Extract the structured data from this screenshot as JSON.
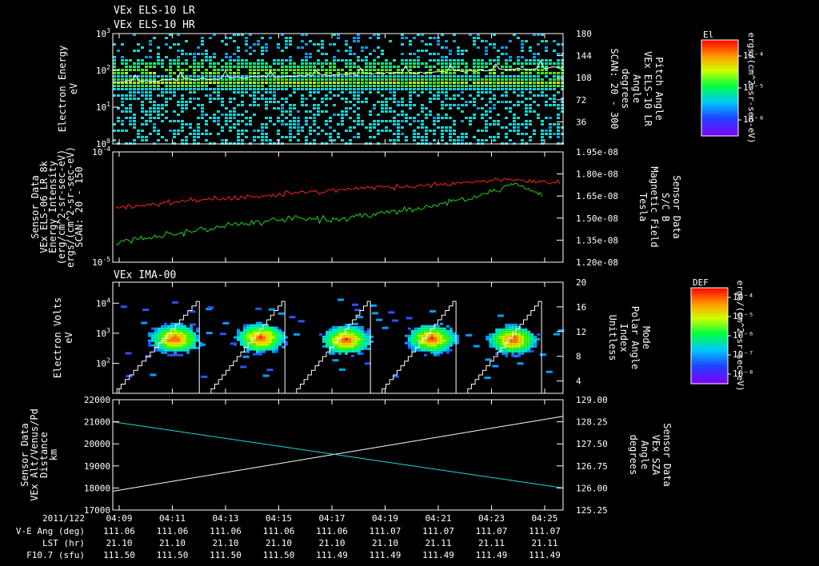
{
  "colors": {
    "background": "#000000",
    "axis": "#ffffff",
    "red_series": "#ff2020",
    "green_series": "#20d020",
    "cyan_series": "#20d8d8",
    "white_series": "#ffffff"
  },
  "chart_data": [
    {
      "id": "panel1",
      "type": "heatmap",
      "titles": [
        "VEx ELS-10 LR",
        "VEx ELS-10 HR"
      ],
      "ylabel": [
        "Electron Energy",
        "eV"
      ],
      "yscale": "log",
      "ylim": [
        1,
        1000
      ],
      "yticks": [
        {
          "v": 1,
          "base": "10",
          "exp": "0"
        },
        {
          "v": 10,
          "base": "10",
          "exp": "1"
        },
        {
          "v": 100,
          "base": "10",
          "exp": "2"
        },
        {
          "v": 1000,
          "base": "10",
          "exp": "3"
        }
      ],
      "y2label": [
        "Pitch Angle",
        "VEx ELS-10 LR",
        "Angle",
        "degrees",
        "SCAN: 20 - 300"
      ],
      "y2lim": [
        0,
        180
      ],
      "y2ticks": [
        "36",
        "72",
        "108",
        "144",
        "180"
      ],
      "overlay_series": {
        "name": "Pitch Angle",
        "color": "#ffffff",
        "band_center_eV": 50,
        "pitch_angle_range": [
          95,
          140
        ]
      },
      "colorbar": {
        "title": "El",
        "unit": "ergs/(cm^2-sr-sec-eV)",
        "labels": [
          "10⁻⁴",
          "10⁻⁵",
          "10⁻⁶"
        ]
      }
    },
    {
      "id": "panel2",
      "type": "line",
      "ylabel": [
        "Sensor Data",
        "VEx ELS-06 LR 8k",
        "Energy Intensity",
        "(erg/cm^2-sr-sec-eV)",
        "ergs/(cm^2-sr-sec-eV)",
        "SCAN: 20 - 150"
      ],
      "ylabel_color": "#ff2020",
      "yscale": "log",
      "ylim": [
        1e-05,
        0.0001
      ],
      "yticks": [
        {
          "v": 1e-05,
          "base": "10",
          "exp": "-5"
        },
        {
          "v": 0.0001,
          "base": "10",
          "exp": "-4"
        }
      ],
      "y2label": [
        "Sensor Data",
        "S/C B",
        "Magnetic Field",
        "Tesla"
      ],
      "y2label_color": "#20d020",
      "y2lim": [
        1.2e-08,
        1.95e-08
      ],
      "y2ticks": [
        "1.20e-08",
        "1.35e-08",
        "1.50e-08",
        "1.65e-08",
        "1.80e-08",
        "1.95e-08"
      ],
      "series": [
        {
          "axis": "left",
          "color": "#ff2020",
          "x": [
            0,
            0.1,
            0.2,
            0.3,
            0.4,
            0.5,
            0.6,
            0.7,
            0.8,
            0.9,
            1.0
          ],
          "values": [
            3.1e-05,
            3.4e-05,
            3.7e-05,
            3.9e-05,
            4.2e-05,
            4.5e-05,
            4.8e-05,
            5e-05,
            5.3e-05,
            5.6e-05,
            5.2e-05
          ]
        },
        {
          "axis": "right",
          "color": "#20d020",
          "x": [
            0,
            0.1,
            0.2,
            0.3,
            0.4,
            0.5,
            0.6,
            0.7,
            0.8,
            0.9,
            0.96
          ],
          "values": [
            1.34e-08,
            1.38e-08,
            1.42e-08,
            1.46e-08,
            1.5e-08,
            1.49e-08,
            1.53e-08,
            1.57e-08,
            1.64e-08,
            1.73e-08,
            1.66e-08
          ]
        }
      ]
    },
    {
      "id": "panel3",
      "type": "heatmap",
      "titles": [
        "VEx IMA-00"
      ],
      "ylabel": [
        "Electron Volts",
        "eV"
      ],
      "yscale": "log",
      "ylim": [
        10,
        50000
      ],
      "yticks": [
        {
          "v": 100,
          "base": "10",
          "exp": "2"
        },
        {
          "v": 1000,
          "base": "10",
          "exp": "3"
        },
        {
          "v": 10000,
          "base": "10",
          "exp": "4"
        }
      ],
      "y2label": [
        "Mode",
        "Polar Angle",
        "Index",
        "Unitless"
      ],
      "y2lim": [
        2,
        20
      ],
      "y2ticks": [
        "4",
        "8",
        "12",
        "16",
        "20"
      ],
      "blobs": [
        {
          "x": 0.135,
          "energy_eV": 700
        },
        {
          "x": 0.325,
          "energy_eV": 750
        },
        {
          "x": 0.515,
          "energy_eV": 650
        },
        {
          "x": 0.705,
          "energy_eV": 700
        },
        {
          "x": 0.885,
          "energy_eV": 650
        }
      ],
      "sawtooth_periods": [
        0.0,
        0.21,
        0.4,
        0.59,
        0.78,
        0.97
      ],
      "colorbar": {
        "title": "DEF",
        "unit": "ergs/(cm^2-sr-sec-eV)",
        "labels": [
          "10⁻⁴",
          "10⁻⁵",
          "10⁻⁶",
          "10⁻⁷",
          "10⁻⁸"
        ]
      }
    },
    {
      "id": "panel4",
      "type": "line",
      "ylabel": [
        "Sensor Data",
        "VEx Alt/Venus/Pd",
        "Distance",
        "km"
      ],
      "ylim": [
        17000,
        22000
      ],
      "yticks": [
        "17000",
        "18000",
        "19000",
        "20000",
        "21000",
        "22000"
      ],
      "y2label": [
        "Sensor Data",
        "VEx SZA",
        "Angle",
        "degrees"
      ],
      "y2label_color": "#20d8d8",
      "y2lim": [
        125.25,
        129.0
      ],
      "y2ticks": [
        "125.25",
        "126.00",
        "126.75",
        "127.50",
        "128.25",
        "129.00"
      ],
      "series": [
        {
          "axis": "left",
          "color": "#ffffff",
          "x": [
            0,
            1
          ],
          "values": [
            17850,
            21250
          ]
        },
        {
          "axis": "right",
          "color": "#20d8d8",
          "x": [
            0,
            1
          ],
          "values": [
            128.25,
            126.0
          ]
        }
      ]
    }
  ],
  "time_axis": {
    "row_labels": [
      "2011/122",
      "V-E Ang (deg)",
      "LST (hr)",
      "F10.7 (sfu)"
    ],
    "ticks": [
      {
        "time": "04:09",
        "ang": "111.06",
        "lst": "21.10",
        "f107": "111.50"
      },
      {
        "time": "04:11",
        "ang": "111.06",
        "lst": "21.10",
        "f107": "111.50"
      },
      {
        "time": "04:13",
        "ang": "111.06",
        "lst": "21.10",
        "f107": "111.50"
      },
      {
        "time": "04:15",
        "ang": "111.06",
        "lst": "21.10",
        "f107": "111.50"
      },
      {
        "time": "04:17",
        "ang": "111.06",
        "lst": "21.10",
        "f107": "111.49"
      },
      {
        "time": "04:19",
        "ang": "111.07",
        "lst": "21.10",
        "f107": "111.49"
      },
      {
        "time": "04:21",
        "ang": "111.07",
        "lst": "21.11",
        "f107": "111.49"
      },
      {
        "time": "04:23",
        "ang": "111.07",
        "lst": "21.11",
        "f107": "111.49"
      },
      {
        "time": "04:25",
        "ang": "111.07",
        "lst": "21.11",
        "f107": "111.49"
      }
    ]
  }
}
